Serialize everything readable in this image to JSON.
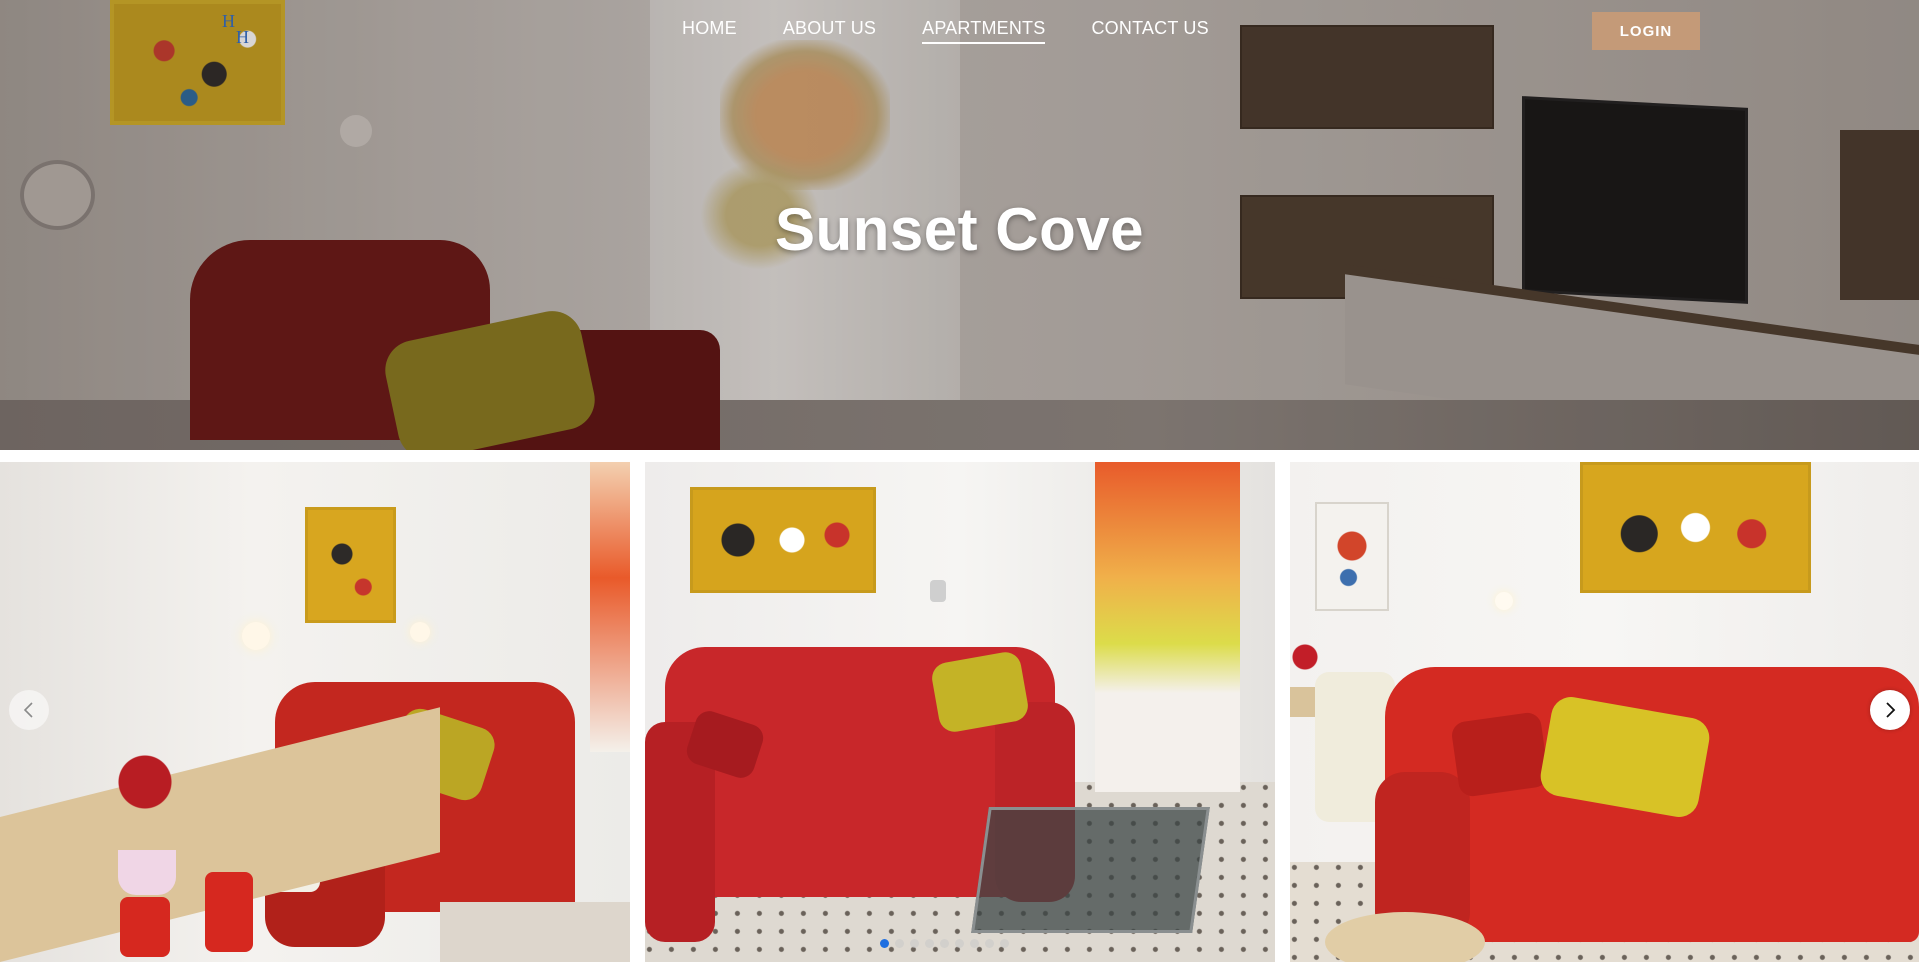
{
  "header": {
    "logo_icon": "hh-logo-icon",
    "nav": [
      {
        "label": "HOME",
        "active": false
      },
      {
        "label": "ABOUT US",
        "active": false
      },
      {
        "label": "APARTMENTS",
        "active": true
      },
      {
        "label": "CONTACT US",
        "active": false
      }
    ],
    "login_label": "LOGIN"
  },
  "hero": {
    "title": "Sunset Cove"
  },
  "gallery": {
    "prev_icon": "chevron-left-icon",
    "next_icon": "chevron-right-icon",
    "slide_count": 9,
    "active_slide": 1
  },
  "colors": {
    "login_button": "#c49a78",
    "active_dot": "#1f6fe0",
    "nav_text": "#ffffff"
  }
}
